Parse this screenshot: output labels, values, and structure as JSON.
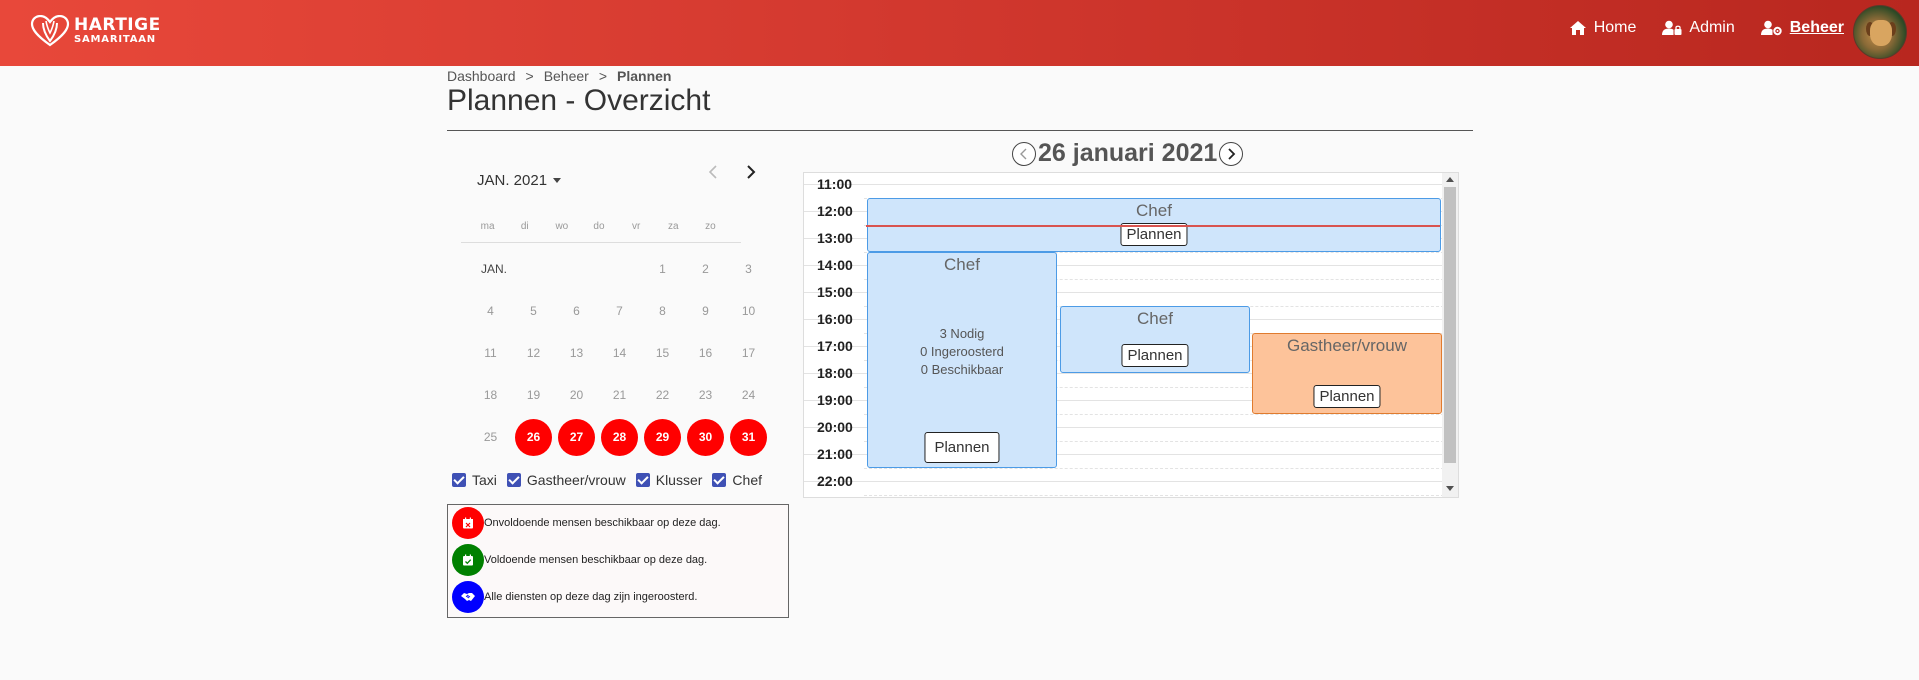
{
  "brand": {
    "line1": "HARTIGE",
    "line2": "SAMARITAAN"
  },
  "nav": {
    "home": "Home",
    "admin": "Admin",
    "beheer": "Beheer"
  },
  "breadcrumb": {
    "items": [
      "Dashboard",
      "Beheer"
    ],
    "current": "Plannen",
    "separator": ">"
  },
  "page_title": "Plannen - Overzicht",
  "mini_calendar": {
    "month_label": "JAN. 2021",
    "weekdays": [
      "ma",
      "di",
      "wo",
      "do",
      "vr",
      "za",
      "zo"
    ],
    "row_label": "JAN.",
    "weeks": [
      [
        "",
        "",
        "",
        "",
        "1",
        "2",
        "3"
      ],
      [
        "4",
        "5",
        "6",
        "7",
        "8",
        "9",
        "10"
      ],
      [
        "11",
        "12",
        "13",
        "14",
        "15",
        "16",
        "17"
      ],
      [
        "18",
        "19",
        "20",
        "21",
        "22",
        "23",
        "24"
      ],
      [
        "25",
        "26",
        "27",
        "28",
        "29",
        "30",
        "31"
      ]
    ],
    "highlighted_days": [
      "26",
      "27",
      "28",
      "29",
      "30",
      "31"
    ],
    "highlight_color": "#ff0000"
  },
  "filters": [
    {
      "label": "Taxi",
      "checked": true
    },
    {
      "label": "Gastheer/vrouw",
      "checked": true
    },
    {
      "label": "Klusser",
      "checked": true
    },
    {
      "label": "Chef",
      "checked": true
    }
  ],
  "legend": [
    {
      "color": "#ff0000",
      "icon": "calendar-x-icon",
      "text": "Onvoldoende mensen beschikbaar op deze dag."
    },
    {
      "color": "#008000",
      "icon": "calendar-check-icon",
      "text": "Voldoende mensen beschikbaar op deze dag."
    },
    {
      "color": "#0000ff",
      "icon": "handshake-icon",
      "text": "Alle diensten op deze dag zijn ingeroosterd."
    }
  ],
  "day_view": {
    "date_title": "26 januari 2021",
    "hours": [
      "11:00",
      "12:00",
      "13:00",
      "14:00",
      "15:00",
      "16:00",
      "17:00",
      "18:00",
      "19:00",
      "20:00",
      "21:00",
      "22:00"
    ],
    "current_time": "12:30",
    "events": [
      {
        "title": "Chef",
        "start": "11:30",
        "end": "13:30",
        "color": "blue",
        "button": "Plannen"
      },
      {
        "title": "Chef",
        "start": "13:30",
        "end": "21:30",
        "color": "blue",
        "info": [
          "3 Nodig",
          "0 Ingeroosterd",
          "0 Beschikbaar"
        ],
        "button": "Plannen"
      },
      {
        "title": "Chef",
        "start": "15:30",
        "end": "18:00",
        "color": "blue",
        "button": "Plannen"
      },
      {
        "title": "Gastheer/vrouw",
        "start": "16:30",
        "end": "19:30",
        "color": "orange",
        "button": "Plannen"
      }
    ]
  }
}
